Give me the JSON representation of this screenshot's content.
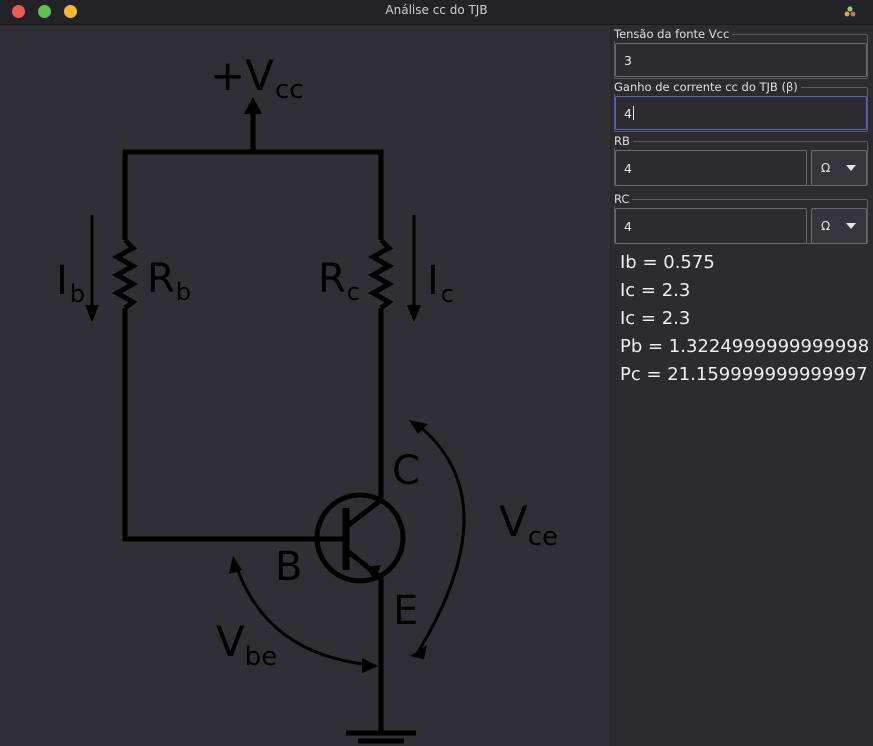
{
  "window": {
    "title": "Análise cc do TJB"
  },
  "schematic": {
    "vcc_main": "+V",
    "vcc_sub": "cc",
    "ib_main": "I",
    "ib_sub": "b",
    "rb_main": "R",
    "rb_sub": "b",
    "rc_main": "R",
    "rc_sub": "c",
    "ic_main": "I",
    "ic_sub": "c",
    "collector": "C",
    "base": "B",
    "emitter": "E",
    "vce_main": "V",
    "vce_sub": "ce",
    "vbe_main": "V",
    "vbe_sub": "be"
  },
  "form": {
    "vcc": {
      "label": "Tensão da fonte Vcc",
      "value": "3"
    },
    "beta": {
      "label": "Ganho de corrente cc do TJB (β)",
      "value": "4"
    },
    "rb": {
      "label": "RB",
      "value": "4",
      "unit": "Ω"
    },
    "rc": {
      "label": "RC",
      "value": "4",
      "unit": "Ω"
    }
  },
  "results": [
    "Ib = 0.575",
    "Ic = 2.3",
    "Ic = 2.3",
    "Pb = 1.3224999999999998",
    "Pc = 21.159999999999997"
  ],
  "colors": {
    "close": "#ec5b57",
    "minimize": "#5fc152",
    "maximize": "#f4b634",
    "focus": "#5b5fd6"
  }
}
